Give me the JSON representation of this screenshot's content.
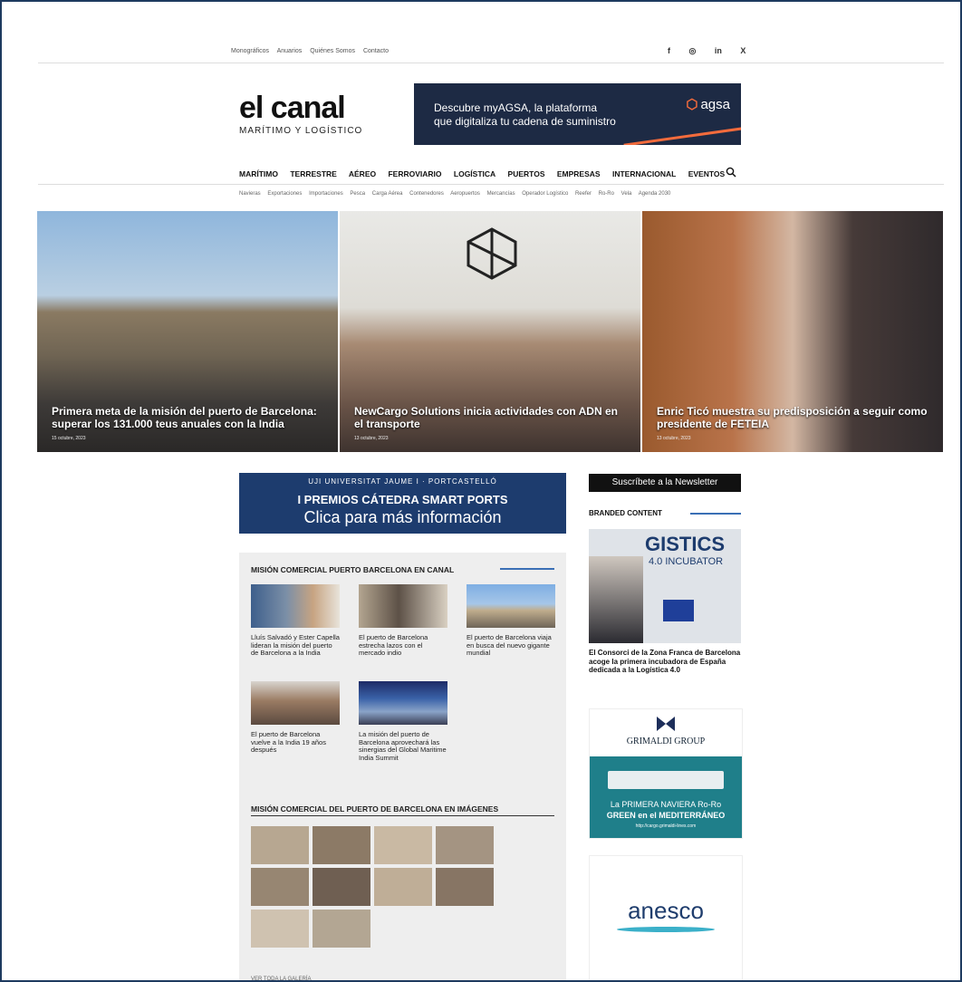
{
  "topbar": {
    "links": [
      "Monográficos",
      "Anuarios",
      "Quiénes Somos",
      "Contacto"
    ],
    "social": [
      "f",
      "◎",
      "in",
      "X"
    ]
  },
  "logo": {
    "title": "el canal",
    "subtitle": "MARÍTIMO Y LOGÍSTICO"
  },
  "banner": {
    "line1": "Descubre myAGSA, la plataforma",
    "line2": "que digitaliza tu cadena de suministro",
    "brand": "agsa"
  },
  "nav": [
    "MARÍTIMO",
    "TERRESTRE",
    "AÉREO",
    "FERROVIARIO",
    "LOGÍSTICA",
    "PUERTOS",
    "EMPRESAS",
    "INTERNACIONAL",
    "EVENTOS"
  ],
  "subnav": [
    "Navieras",
    "Exportaciones",
    "Importaciones",
    "Pesca",
    "Carga Aérea",
    "Contenedores",
    "Aeropuertos",
    "Mercancías",
    "Operador Logístico",
    "Reefer",
    "Ro-Ro",
    "Vela",
    "Agenda 2030"
  ],
  "hero": [
    {
      "title": "Primera meta de la misión del puerto de Barcelona: superar los 131.000 teus anuales con la India",
      "date": "15 octubre, 2023"
    },
    {
      "title": "NewCargo Solutions inicia actividades con ADN en el transporte",
      "date": "13 octubre, 2023"
    },
    {
      "title": "Enric Ticó muestra su predisposición a seguir como presidente de FETEIA",
      "date": "13 octubre, 2023"
    }
  ],
  "ad2": {
    "line1": "UJI UNIVERSITAT JAUME I · PORTCASTELLÓ",
    "line2": "I PREMIOS CÁTEDRA SMART PORTS",
    "line3": "Clica para más información"
  },
  "section1": {
    "title": "MISIÓN COMERCIAL PUERTO BARCELONA EN CANAL",
    "items": [
      "Lluís Salvadó y Ester Capella lideran la misión del puerto de Barcelona a la India",
      "El puerto de Barcelona estrecha lazos con el mercado indio",
      "El puerto de Barcelona viaja en busca del nuevo gigante mundial",
      "El puerto de Barcelona vuelve a la India 19 años después",
      "La misión del puerto de Barcelona aprovechará las sinergias del Global Maritime India Summit"
    ]
  },
  "section2": {
    "title": "MISIÓN COMERCIAL DEL PUERTO DE BARCELONA EN IMÁGENES",
    "more": "VER TODA LA GALERÍA"
  },
  "sidebar": {
    "newsletter": "Suscríbete a la Newsletter",
    "branded": "BRANDED CONTENT",
    "bc_img_title": "GISTICS",
    "bc_img_sub": "4.0 INCUBATOR",
    "bc_caption": "El Consorci de la Zona Franca de Barcelona acoge la primera incubadora de España dedicada a la Logística 4.0",
    "grimaldi": {
      "name": "GRIMALDI GROUP",
      "l1": "La PRIMERA NAVIERA Ro-Ro",
      "l2": "GREEN en el MEDITERRÁNEO",
      "l3": "http://cargo.grimaldi-lines.com"
    },
    "anesco": "anesco"
  }
}
